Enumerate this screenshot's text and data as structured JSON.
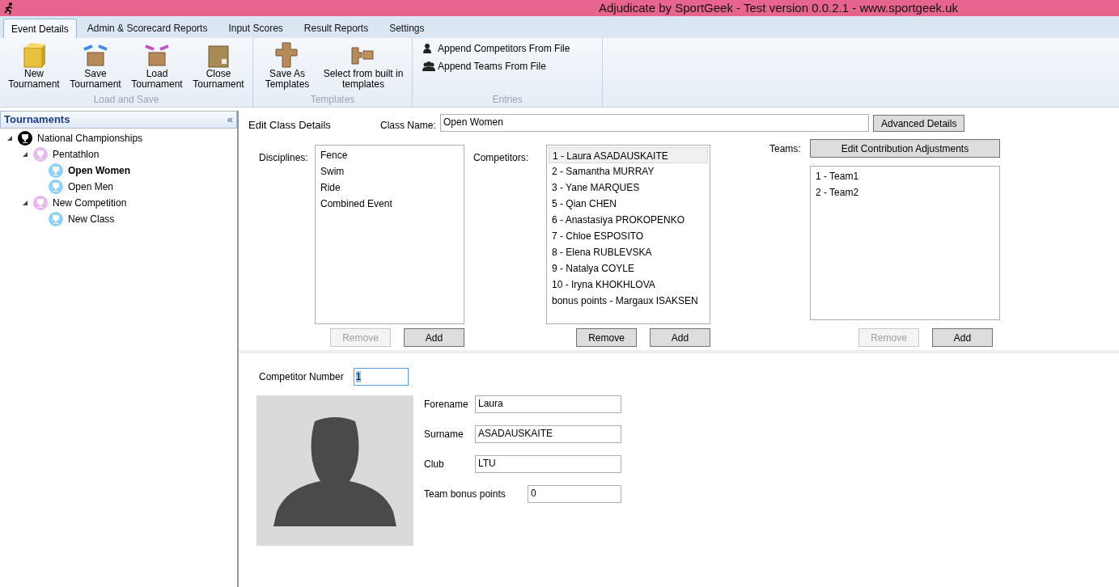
{
  "window": {
    "title": "Adjudicate by SportGeek - Test version 0.0.2.1 - www.sportgeek.uk"
  },
  "tabs": [
    {
      "label": "Event Details",
      "selected": true
    },
    {
      "label": "Admin & Scorecard Reports",
      "selected": false
    },
    {
      "label": "Input Scores",
      "selected": false
    },
    {
      "label": "Result Reports",
      "selected": false
    },
    {
      "label": "Settings",
      "selected": false
    }
  ],
  "ribbon_groups": [
    {
      "label": "Load and Save",
      "items": [
        {
          "kind": "large",
          "label": "New Tournament"
        },
        {
          "kind": "large",
          "label": "Save Tournament"
        },
        {
          "kind": "large",
          "label": "Load Tournament"
        },
        {
          "kind": "large",
          "label": "Close Tournament"
        }
      ]
    },
    {
      "label": "Templates",
      "items": [
        {
          "kind": "large",
          "label": "Save As Templates"
        },
        {
          "kind": "large",
          "label": "Select from built in templates"
        }
      ]
    },
    {
      "label": "Entries",
      "items": [
        {
          "kind": "small",
          "label": "Append Competitors From File"
        },
        {
          "kind": "small",
          "label": "Append Teams From File"
        }
      ]
    }
  ],
  "sidebar": {
    "title": "Tournaments",
    "collapse": "«",
    "tree": [
      {
        "label": "National Championships",
        "kind": "tournament",
        "expanded": true,
        "selected": false,
        "children": [
          {
            "label": "Pentathlon",
            "kind": "competition",
            "expanded": true,
            "selected": false,
            "children": [
              {
                "label": "Open Women",
                "kind": "class",
                "selected": true
              },
              {
                "label": "Open Men",
                "kind": "class",
                "selected": false
              }
            ]
          },
          {
            "label": "New Competition",
            "kind": "competition",
            "expanded": true,
            "selected": false,
            "children": [
              {
                "label": "New Class",
                "kind": "class",
                "selected": false
              }
            ]
          }
        ]
      }
    ]
  },
  "class_details": {
    "heading": "Edit Class Details",
    "class_name_label": "Class Name:",
    "class_name": "Open Women",
    "advanced_button": "Advanced Details",
    "disciplines": {
      "label": "Disciplines:",
      "items": [
        {
          "label": "Fence",
          "selected": false
        },
        {
          "label": "Swim",
          "selected": false
        },
        {
          "label": "Ride",
          "selected": false
        },
        {
          "label": "Combined Event",
          "selected": false
        }
      ],
      "buttons": [
        {
          "label": "Remove",
          "disabled": true
        },
        {
          "label": "Add",
          "disabled": false
        }
      ]
    },
    "competitors": {
      "label": "Competitors:",
      "items": [
        {
          "label": "1 - Laura ASADAUSKAITE",
          "selected": true
        },
        {
          "label": "2 - Samantha MURRAY",
          "selected": false
        },
        {
          "label": "3 - Yane MARQUES",
          "selected": false
        },
        {
          "label": "5 - Qian CHEN",
          "selected": false
        },
        {
          "label": "6 - Anastasiya PROKOPENKO",
          "selected": false
        },
        {
          "label": "7 - Chloe ESPOSITO",
          "selected": false
        },
        {
          "label": "8 - Elena RUBLEVSKA",
          "selected": false
        },
        {
          "label": "9 - Natalya COYLE",
          "selected": false
        },
        {
          "label": "10 - Iryna KHOKHLOVA",
          "selected": false
        },
        {
          "label": "bonus points - Margaux ISAKSEN",
          "selected": false
        }
      ],
      "buttons": [
        {
          "label": "Remove",
          "disabled": false
        },
        {
          "label": "Add",
          "disabled": false
        }
      ]
    },
    "teams": {
      "label": "Teams:",
      "top_button": "Edit Contribution Adjustments",
      "items": [
        {
          "label": "1 - Team1",
          "selected": false
        },
        {
          "label": "2 - Team2",
          "selected": false
        }
      ],
      "buttons": [
        {
          "label": "Remove",
          "disabled": true
        },
        {
          "label": "Add",
          "disabled": false
        }
      ]
    }
  },
  "competitor": {
    "number_label": "Competitor Number",
    "number": "1",
    "fields": [
      {
        "label": "Forename",
        "value": "Laura"
      },
      {
        "label": "Surname",
        "value": "ASADAUSKAITE"
      },
      {
        "label": "Club",
        "value": "LTU"
      },
      {
        "label": "Team bonus points",
        "value": "0"
      }
    ]
  }
}
